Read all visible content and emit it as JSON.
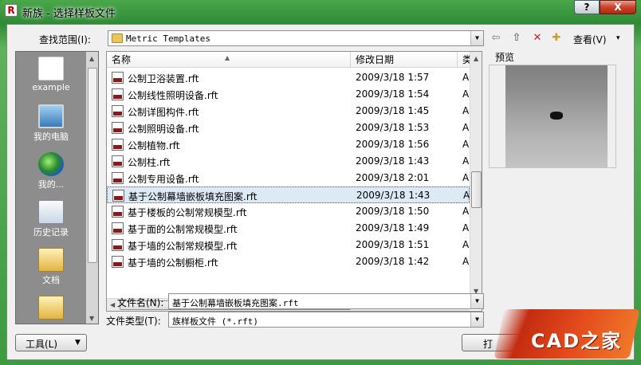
{
  "window": {
    "title": "新族 - 选择样板文件",
    "help_label": "?",
    "close_label": "X",
    "app_icon": "R"
  },
  "toolbar": {
    "lookin_label": "查找范围(I):",
    "lookin_value": "Metric Templates",
    "back_icon": "⇦",
    "up_icon": "⇧",
    "delete_icon": "✕",
    "new_folder_icon": "✚",
    "view_label": "查看(V)",
    "view_arrow": "▾"
  },
  "places": [
    {
      "label": "example",
      "icon": "folder-icon"
    },
    {
      "label": "我的电脑",
      "icon": "computer-icon"
    },
    {
      "label": "我的...",
      "icon": "network-icon"
    },
    {
      "label": "历史记录",
      "icon": "history-icon"
    },
    {
      "label": "文档",
      "icon": "documents-icon"
    }
  ],
  "file_list": {
    "columns": [
      "名称",
      "修改日期",
      "类"
    ],
    "rows": [
      {
        "name": "公制卫浴装置.rft",
        "date": "2009/3/18 1:57",
        "type": "A"
      },
      {
        "name": "公制线性照明设备.rft",
        "date": "2009/3/18 1:54",
        "type": "A"
      },
      {
        "name": "公制详图构件.rft",
        "date": "2009/3/18 1:45",
        "type": "A"
      },
      {
        "name": "公制照明设备.rft",
        "date": "2009/3/18 1:53",
        "type": "A"
      },
      {
        "name": "公制植物.rft",
        "date": "2009/3/18 1:56",
        "type": "A"
      },
      {
        "name": "公制柱.rft",
        "date": "2009/3/18 1:43",
        "type": "A"
      },
      {
        "name": "公制专用设备.rft",
        "date": "2009/3/18 2:01",
        "type": "A"
      },
      {
        "name": "基于公制幕墙嵌板填充图案.rft",
        "date": "2009/3/18 1:43",
        "type": "A",
        "selected": true
      },
      {
        "name": "基于楼板的公制常规模型.rft",
        "date": "2009/3/18 1:50",
        "type": "A"
      },
      {
        "name": "基于面的公制常规模型.rft",
        "date": "2009/3/18 1:49",
        "type": "A"
      },
      {
        "name": "基于墙的公制常规模型.rft",
        "date": "2009/3/18 1:51",
        "type": "A"
      },
      {
        "name": "基于墙的公制橱柜.rft",
        "date": "2009/3/18 1:42",
        "type": "A"
      }
    ],
    "file_icon": "RFT"
  },
  "preview": {
    "label": "预览"
  },
  "filename": {
    "label": "文件名(N):",
    "value": "基于公制幕墙嵌板填充图案.rft"
  },
  "filetype": {
    "label": "文件类型(T):",
    "value": "族样板文件 (*.rft)"
  },
  "buttons": {
    "tools_label": "工具(L)",
    "open_label": "打"
  },
  "watermark": {
    "text": "CAD之家"
  }
}
